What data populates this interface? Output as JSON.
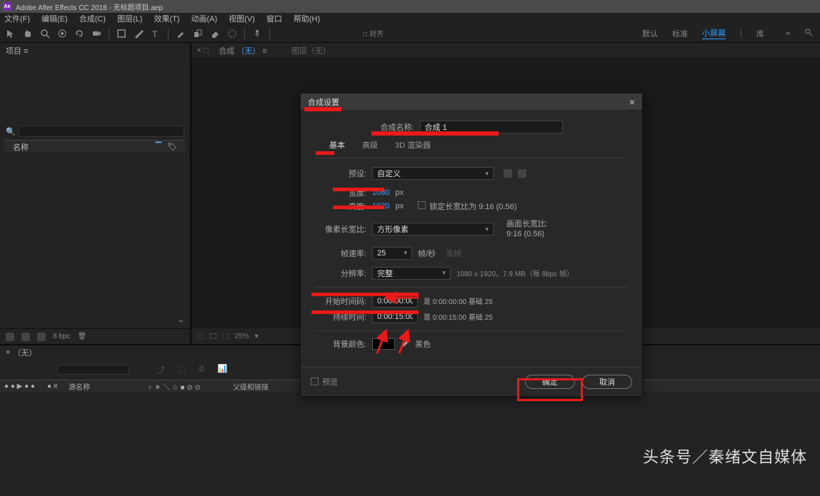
{
  "window": {
    "title": "Adobe After Effects CC 2018 - 无标题项目.aep",
    "icon_text": "Ae"
  },
  "menu": [
    "文件(F)",
    "编辑(E)",
    "合成(C)",
    "图层(L)",
    "效果(T)",
    "动画(A)",
    "视图(V)",
    "窗口",
    "帮助(H)"
  ],
  "toolbar": {
    "snap_label": "□ 对齐",
    "workspaces": [
      "默认",
      "标准",
      "小屏幕",
      "库"
    ],
    "workspace_active_index": 2
  },
  "project_panel": {
    "title": "项目 ≡",
    "search_placeholder": "",
    "col_name": "名称",
    "footer": {
      "bpc": "8 bpc"
    }
  },
  "comp_panel": {
    "tabs": [
      {
        "prefix": "合成",
        "name": "（无）",
        "suffix": "≡"
      },
      {
        "label": "图层（无）"
      }
    ],
    "footer_zoom": "25%"
  },
  "timeline": {
    "tab": "（无）",
    "cols": {
      "switches": "● ● ▶ ● ●",
      "tag": "● #",
      "source": "源名称",
      "modes": "♀ ☀ ＼ ☆ ■ ⊘ ⊙",
      "parent": "父级和链接"
    }
  },
  "dialog": {
    "title": "合成设置",
    "name_label": "合成名称:",
    "name_value": "合成 1",
    "tabs": [
      "基本",
      "高级",
      "3D 渲染器"
    ],
    "preset_label": "预设:",
    "preset_value": "自定义",
    "width_label": "宽度:",
    "width_value": "1080",
    "height_label": "高度:",
    "height_value": "1920",
    "px": "px",
    "lock_label": "锁定长宽比为 9:16 (0.56)",
    "pixel_label": "像素长宽比:",
    "pixel_value": "方形像素",
    "frame_aspect_label": "画面长宽比:",
    "frame_aspect_value": "9:16 (0.56)",
    "fps_label": "帧速率:",
    "fps_value": "25",
    "fps_unit": "帧/秒",
    "fps_drop": "丢帧",
    "res_label": "分辨率:",
    "res_value": "完整",
    "res_info": "1080 x 1920，7.9 MB（每 8bpc 帧）",
    "start_label": "开始时间码:",
    "start_value": "0:00:00:00",
    "start_info": "是 0:00:00:00 基础 25",
    "dur_label": "持续时间:",
    "dur_value": "0:00:15:00",
    "dur_info": "是 0:00:15:00 基础 25",
    "bg_label": "背景颜色:",
    "bg_name": "黑色",
    "preview": "预览",
    "ok": "确定",
    "cancel": "取消"
  },
  "watermark": "头条号／秦绪文自媒体"
}
